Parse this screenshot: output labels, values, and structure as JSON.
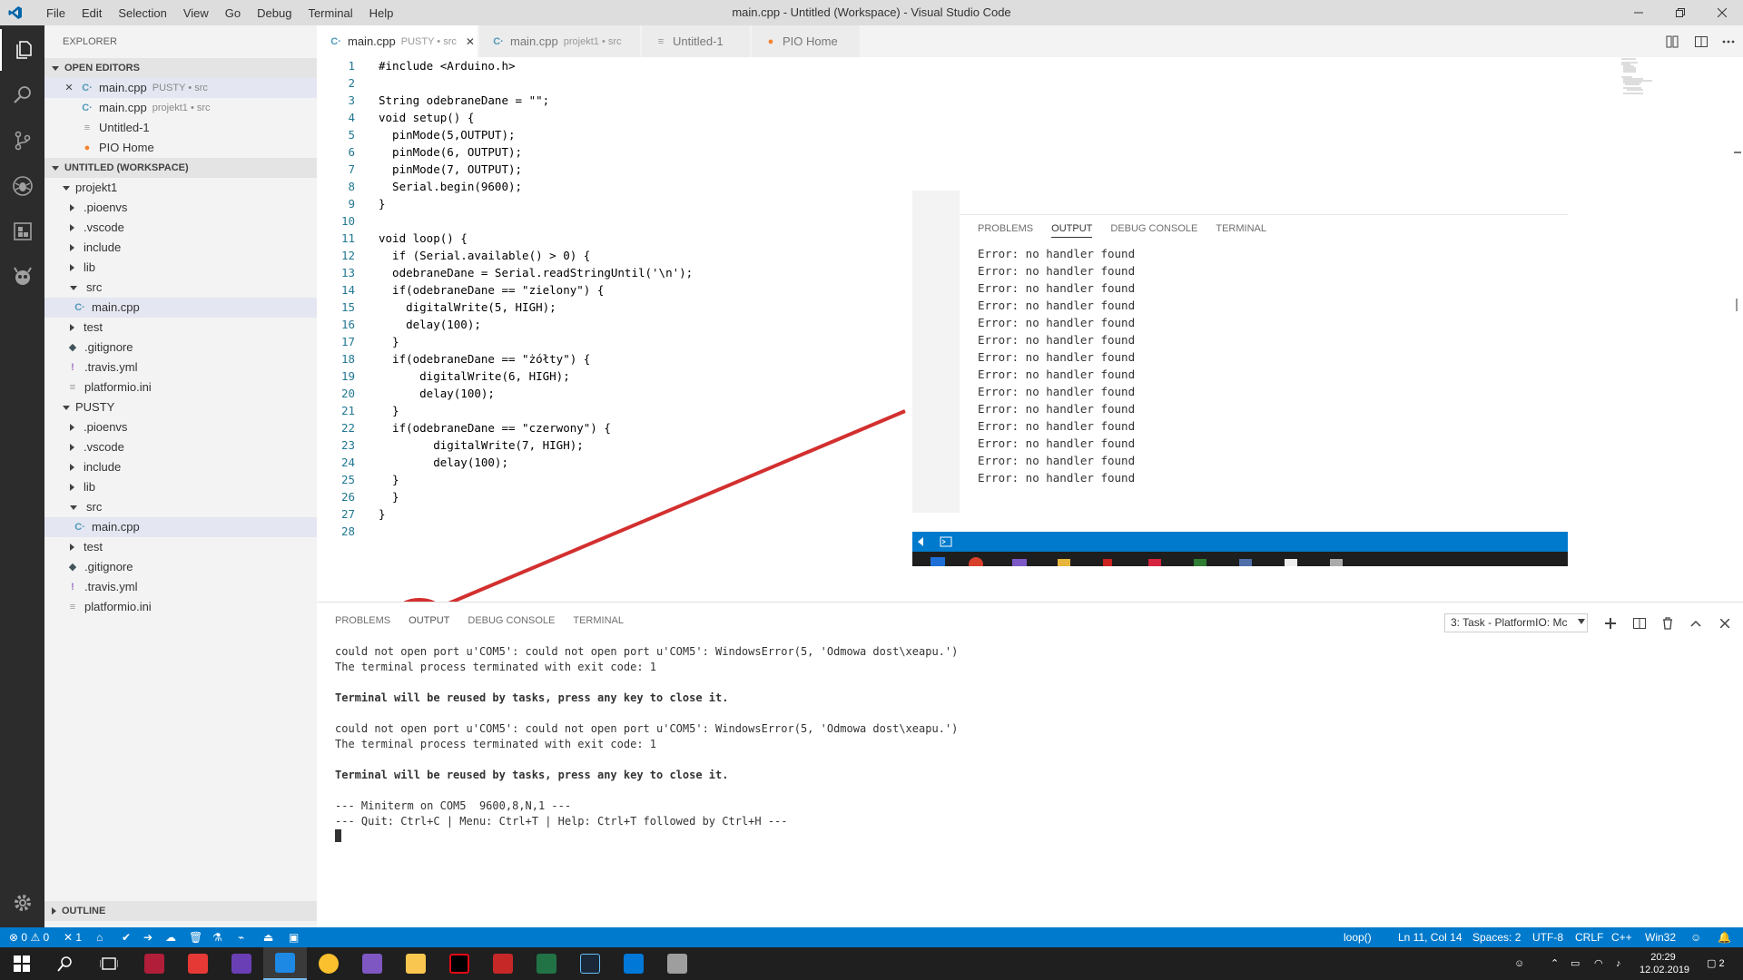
{
  "window": {
    "title": "main.cpp - Untitled (Workspace) - Visual Studio Code",
    "menu": [
      "File",
      "Edit",
      "Selection",
      "View",
      "Go",
      "Debug",
      "Terminal",
      "Help"
    ]
  },
  "sidebar": {
    "header": "EXPLORER",
    "open_editors_title": "OPEN EDITORS",
    "open_editors": [
      {
        "name": "main.cpp",
        "desc": "PUSTY • src"
      },
      {
        "name": "main.cpp",
        "desc": "projekt1 • src"
      },
      {
        "name": "Untitled-1",
        "desc": ""
      },
      {
        "name": "PIO Home",
        "desc": ""
      }
    ],
    "workspace_title": "UNTITLED (WORKSPACE)",
    "projekt1": {
      "name": "projekt1",
      "items": [
        ".pioenvs",
        ".vscode",
        "include",
        "lib",
        "src",
        "main.cpp",
        "test",
        ".gitignore",
        ".travis.yml",
        "platformio.ini"
      ]
    },
    "pusty": {
      "name": "PUSTY",
      "items": [
        ".pioenvs",
        ".vscode",
        "include",
        "lib",
        "src",
        "main.cpp",
        "test",
        ".gitignore",
        ".travis.yml",
        "platformio.ini"
      ]
    },
    "outline_title": "OUTLINE"
  },
  "tabs": [
    {
      "label": "main.cpp",
      "desc": "PUSTY • src"
    },
    {
      "label": "main.cpp",
      "desc": "projekt1 • src"
    },
    {
      "label": "Untitled-1",
      "desc": ""
    },
    {
      "label": "PIO Home",
      "desc": ""
    }
  ],
  "editor": {
    "line_numbers": [
      "1",
      "2",
      "3",
      "4",
      "5",
      "6",
      "7",
      "8",
      "9",
      "10",
      "11",
      "12",
      "13",
      "14",
      "15",
      "16",
      "17",
      "18",
      "19",
      "20",
      "21",
      "22",
      "23",
      "24",
      "25",
      "26",
      "27",
      "28"
    ],
    "lines": [
      "#include <Arduino.h>",
      "",
      "String odebraneDane = \"\";",
      "void setup() {",
      "  pinMode(5,OUTPUT);",
      "  pinMode(6, OUTPUT);",
      "  pinMode(7, OUTPUT);",
      "  Serial.begin(9600);",
      "}",
      "",
      "void loop() {",
      "  if (Serial.available() > 0) {",
      "  odebraneDane = Serial.readStringUntil('\\n');",
      "  if(odebraneDane == \"zielony\") {",
      "    digitalWrite(5, HIGH);",
      "    delay(100);",
      "  }",
      "  if(odebraneDane == \"żółty\") {",
      "      digitalWrite(6, HIGH);",
      "      delay(100);",
      "  }",
      "  if(odebraneDane == \"czerwony\") {",
      "        digitalWrite(7, HIGH);",
      "        delay(100);",
      "  }",
      "  }",
      "}",
      ""
    ]
  },
  "overlay": {
    "tabs": [
      "PROBLEMS",
      "OUTPUT",
      "DEBUG CONSOLE",
      "TERMINAL"
    ],
    "lines": [
      "Error: no handler found",
      "Error: no handler found",
      "Error: no handler found",
      "Error: no handler found",
      "Error: no handler found",
      "Error: no handler found",
      "Error: no handler found",
      "Error: no handler found",
      "Error: no handler found",
      "Error: no handler found",
      "Error: no handler found",
      "Error: no handler found",
      "Error: no handler found",
      "Error: no handler found"
    ]
  },
  "panel": {
    "tabs": [
      "PROBLEMS",
      "OUTPUT",
      "DEBUG CONSOLE",
      "TERMINAL"
    ],
    "task_select": "3: Task - PlatformIO: Mc",
    "lines": [
      "could not open port u'COM5': could not open port u'COM5': WindowsError(5, 'Odmowa dost\\xeapu.')",
      "The terminal process terminated with exit code: 1",
      "",
      "Terminal will be reused by tasks, press any key to close it.",
      "",
      "could not open port u'COM5': could not open port u'COM5': WindowsError(5, 'Odmowa dost\\xeapu.')",
      "The terminal process terminated with exit code: 1",
      "",
      "Terminal will be reused by tasks, press any key to close it.",
      "",
      "--- Miniterm on COM5  9600,8,N,1 ---",
      "--- Quit: Ctrl+C | Menu: Ctrl+T | Help: Ctrl+T followed by Ctrl+H ---"
    ]
  },
  "status": {
    "errors": "0",
    "warnings": "0",
    "x_count": "1",
    "function": "loop()",
    "position": "Ln 11, Col 14",
    "spaces": "Spaces: 2",
    "encoding": "UTF-8",
    "eol": "CRLF",
    "language": "C++",
    "platform": "Win32"
  },
  "taskbar": {
    "time": "20:29",
    "date": "12.02.2019",
    "notifications": "2"
  },
  "colors": {
    "accent": "#007acc",
    "annotation": "#d32f2f"
  }
}
